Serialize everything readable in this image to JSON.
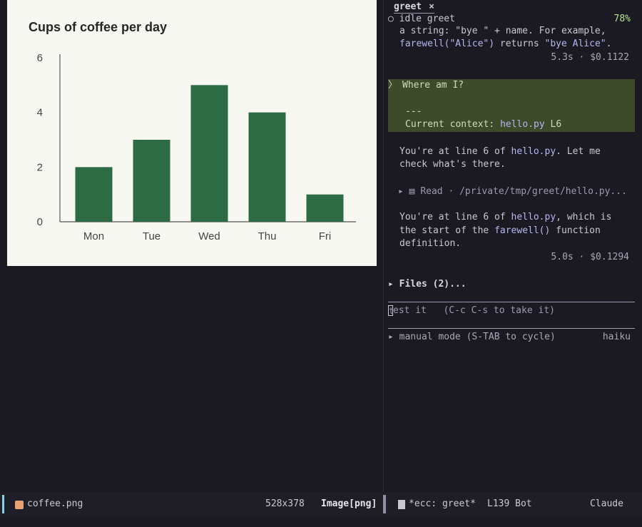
{
  "image_pane": {
    "chart_data": {
      "type": "bar",
      "title": "Cups of coffee per day",
      "categories": [
        "Mon",
        "Tue",
        "Wed",
        "Thu",
        "Fri"
      ],
      "values": [
        2,
        3,
        5,
        4,
        1
      ],
      "yticks": [
        0,
        2,
        4,
        6
      ],
      "ylim": [
        0,
        6
      ],
      "bar_color": "#2d6b45",
      "grid": false
    }
  },
  "chat": {
    "tab_label": "greet",
    "tab_close": "×",
    "status_icon": "○",
    "status_text": "idle",
    "status_session": "greet",
    "status_percent": "78%",
    "msg1_line1": "a string: \"bye \" + name. For example,",
    "msg1_line2_a": "farewell(\"Alice\")",
    "msg1_line2_b": " returns ",
    "msg1_line2_c": "\"bye Alice\"",
    "msg1_line2_d": ".",
    "msg1_meta": "5.3s · $0.1122",
    "prompt_chevron": "〉",
    "prompt_text": "Where am I?",
    "prompt_sep": "---",
    "prompt_context_label": "Current context: ",
    "prompt_context_file": "hello.py",
    "prompt_context_line": " L6",
    "msg2_line1_a": "You're at line 6 of ",
    "msg2_line1_b": "hello.py",
    "msg2_line1_c": ". Let me",
    "msg2_line2": "check what's there.",
    "tool_arrow": "▸",
    "tool_name": "Read",
    "tool_path": " · /private/tmp/greet/hello.py...",
    "msg3_line1_a": "You're at line 6 of ",
    "msg3_line1_b": "hello.py",
    "msg3_line1_c": ", which is",
    "msg3_line2_a": "the start of the ",
    "msg3_line2_b": "farewell()",
    "msg3_line2_c": " function",
    "msg3_line3": "definition.",
    "msg3_meta": "5.0s · $0.1294",
    "files_label": "▸ Files (2)...",
    "input_placeholder": "est it   (C-c C-s to take it)",
    "input_first_char": "t",
    "mode_label": "▸ manual mode (S-TAB to cycle)",
    "model_name": "haiku"
  },
  "modeline": {
    "file_name": "coffee.png",
    "dimensions": "528x378",
    "mode": "Image[png]",
    "buffer_name": "*ecc: greet*",
    "position": "L139 Bot",
    "major_mode": "Claude"
  }
}
